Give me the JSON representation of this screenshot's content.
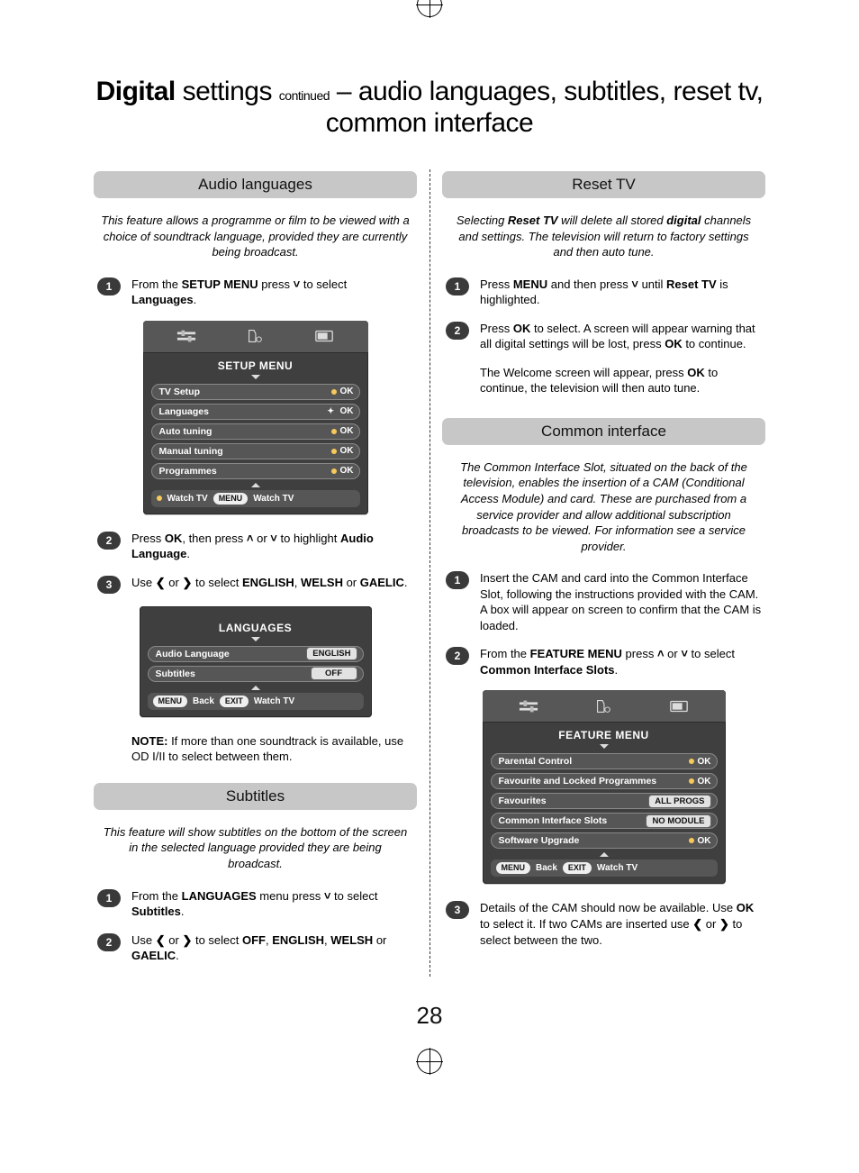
{
  "title": {
    "bold1": "Digital",
    "p1": " settings ",
    "sub": "continued",
    "p2": " – audio languages, subtitles, reset tv, common interface"
  },
  "pageNumber": "28",
  "audio": {
    "heading": "Audio languages",
    "intro": "This feature allows a programme or film to be viewed with a choice of soundtrack language, provided they are currently being broadcast.",
    "step1a": "From the ",
    "step1b": "SETUP MENU",
    "step1c": " press ",
    "step1d": " to select ",
    "step1e": "Languages",
    "step1f": ".",
    "step2a": "Press ",
    "step2b": "OK",
    "step2c": ", then press ",
    "step2d": " or ",
    "step2e": " to highlight ",
    "step2f": "Audio Language",
    "step2g": ".",
    "step3a": "Use ",
    "step3b": " or ",
    "step3c": " to select ",
    "step3d": "ENGLISH",
    "step3e": ", ",
    "step3f": "WELSH",
    "step3g": " or ",
    "step3h": "GAELIC",
    "step3i": ".",
    "noteLabel": "NOTE:",
    "noteText": " If more than one soundtrack is available, use ",
    "noteSym": "OD I/II",
    "noteText2": " to select between them."
  },
  "setupMenu": {
    "title": "SETUP MENU",
    "rows": [
      "TV Setup",
      "Languages",
      "Auto tuning",
      "Manual tuning",
      "Programmes"
    ],
    "ok": "OK",
    "foot1": "Watch TV",
    "footPill": "MENU",
    "foot2": "Watch TV"
  },
  "langMenu": {
    "title": "LANGUAGES",
    "row1": "Audio Language",
    "val1": "ENGLISH",
    "row2": "Subtitles",
    "val2": "OFF",
    "pill1": "MENU",
    "foot1": "Back",
    "pill2": "EXIT",
    "foot2": "Watch TV"
  },
  "subtitles": {
    "heading": "Subtitles",
    "intro": "This feature will show subtitles on the bottom of the screen in the selected language provided they are being broadcast.",
    "s1a": "From the ",
    "s1b": "LANGUAGES",
    "s1c": " menu press ",
    "s1d": " to select ",
    "s1e": "Subtitles",
    "s1f": ".",
    "s2a": "Use ",
    "s2b": " or ",
    "s2c": " to select ",
    "s2d": "OFF",
    "s2e": ", ",
    "s2f": "ENGLISH",
    "s2g": ", ",
    "s2h": "WELSH",
    "s2i": " or ",
    "s2j": "GAELIC",
    "s2k": "."
  },
  "reset": {
    "heading": "Reset TV",
    "introA": "Selecting ",
    "introB": "Reset TV",
    "introC": " will delete all stored ",
    "introD": "digital",
    "introE": " channels and settings. The television will return to factory settings and then auto tune.",
    "s1a": "Press ",
    "s1b": "MENU",
    "s1c": " and then press ",
    "s1d": " until ",
    "s1e": "Reset TV",
    "s1f": " is highlighted.",
    "s2a": "Press ",
    "s2b": "OK",
    "s2c": " to select. A screen will appear warning that all digital settings will be lost, press ",
    "s2d": "OK",
    "s2e": " to continue.",
    "s3": "The Welcome screen will appear, press ",
    "s3b": "OK",
    "s3c": " to continue, the television will then auto tune."
  },
  "common": {
    "heading": "Common interface",
    "intro": "The Common Interface Slot, situated on the back of the television, enables the insertion of a CAM (Conditional Access Module) and card. These are purchased from a service provider and allow additional subscription broadcasts to be viewed. For information see a service provider.",
    "s1": "Insert the CAM and card into the Common Interface Slot, following the instructions provided with the CAM. A box will appear on screen to confirm that the CAM is loaded.",
    "s2a": "From the ",
    "s2b": "FEATURE MENU",
    "s2c": " press ",
    "s2d": " or ",
    "s2e": " to select ",
    "s2f": "Common Interface Slots",
    "s2g": ".",
    "s3a": "Details of the CAM should now be available. Use ",
    "s3b": "OK",
    "s3c": " to select it. If two CAMs are inserted use ",
    "s3d": " or ",
    "s3e": " to select between the two."
  },
  "featureMenu": {
    "title": "FEATURE MENU",
    "r1": "Parental Control",
    "r2": "Favourite and Locked Programmes",
    "r3": "Favourites",
    "v3": "ALL PROGS",
    "r4": "Common Interface Slots",
    "v4": "NO MODULE",
    "r5": "Software Upgrade",
    "ok": "OK",
    "pill1": "MENU",
    "foot1": "Back",
    "pill2": "EXIT",
    "foot2": "Watch TV"
  },
  "nums": {
    "n1": "1",
    "n2": "2",
    "n3": "3"
  }
}
